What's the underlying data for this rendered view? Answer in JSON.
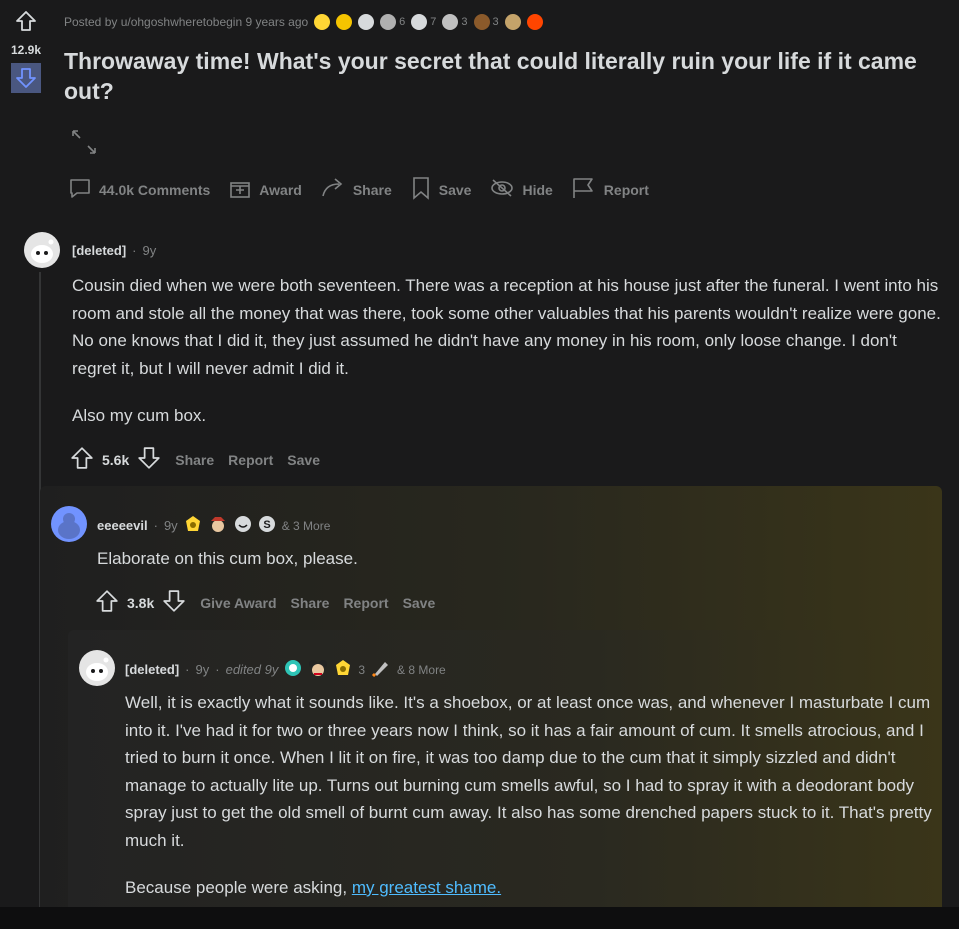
{
  "post": {
    "score": "12.9k",
    "meta_prefix": "Posted by u/ohgoshwheretobegin 9 years ago",
    "awards": [
      {
        "icon": "gold-bar-icon",
        "color": "#ffd635",
        "count": ""
      },
      {
        "icon": "helpful-award-icon",
        "color": "#f5c400",
        "count": ""
      },
      {
        "icon": "f-award-icon",
        "color": "#d7dadc",
        "count": ""
      },
      {
        "icon": "bird-award-icon",
        "color": "#b0b0b0",
        "count": "6"
      },
      {
        "icon": "grin-award-icon",
        "color": "#d7dadc",
        "count": "7"
      },
      {
        "icon": "silver-award-icon",
        "color": "#c0c0c0",
        "count": "3"
      },
      {
        "icon": "poop-award-icon",
        "color": "#8b5a2b",
        "count": "3"
      },
      {
        "icon": "face-palm-award-icon",
        "color": "#c4a36a",
        "count": ""
      },
      {
        "icon": "snoo-award-icon",
        "color": "#ff4500",
        "count": ""
      }
    ],
    "title": "Throwaway time! What's your secret that could literally ruin your life if it came out?",
    "actions": {
      "comments": "44.0k Comments",
      "award": "Award",
      "share": "Share",
      "save": "Save",
      "hide": "Hide",
      "report": "Report"
    }
  },
  "comments": [
    {
      "user": "[deleted]",
      "age": "9y",
      "paragraphs": [
        "Cousin died when we were both seventeen. There was a reception at his house just after the funeral. I went into his room and stole all the money that was there, took some other valuables that his parents wouldn't realize were gone. No one knows that I did it, they just assumed he didn't have any money in his room, only loose change. I don't regret it, but I will never admit I did it.",
        "Also my cum box."
      ],
      "score": "5.6k",
      "actions": [
        "Share",
        "Report",
        "Save"
      ]
    },
    {
      "user": "eeeeevil",
      "age": "9y",
      "more": "& 3 More",
      "paragraphs": [
        "Elaborate on this cum box, please."
      ],
      "score": "3.8k",
      "actions": [
        "Give Award",
        "Share",
        "Report",
        "Save"
      ]
    },
    {
      "user": "[deleted]",
      "age": "9y",
      "edited": "edited 9y",
      "award_count": "3",
      "more": "& 8 More",
      "paragraphs": [
        "Well, it is exactly what it sounds like. It's a shoebox, or at least once was, and whenever I masturbate I cum into it. I've had it for two or three years now I think, so it has a fair amount of cum. It smells atrocious, and I tried to burn it once. When I lit it on fire, it was too damp due to the cum that it simply sizzled and didn't manage to actually lite up. Turns out burning cum smells awful, so I had to spray it with a deodorant body spray just to get the old smell of burnt cum away. It also has some drenched papers stuck to it. That's pretty much it."
      ],
      "link_prefix": "Because people were asking, ",
      "link_text": "my greatest shame."
    }
  ]
}
